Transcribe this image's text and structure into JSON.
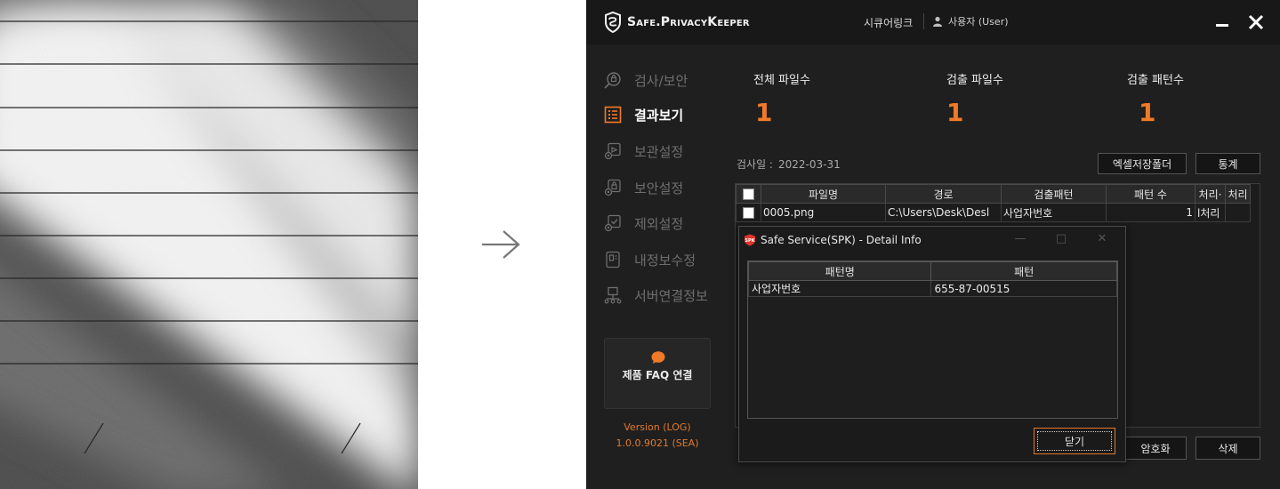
{
  "window": {
    "brand": "Safe.PrivacyKeeper",
    "link": "시큐어링크",
    "user": "사용자 (User)"
  },
  "sidebar": {
    "items": [
      {
        "label": "검사/보안",
        "icon": "shield-search-icon"
      },
      {
        "label": "결과보기",
        "icon": "list-icon",
        "active": true
      },
      {
        "label": "보관설정",
        "icon": "archive-gear-icon"
      },
      {
        "label": "보안설정",
        "icon": "lock-gear-icon"
      },
      {
        "label": "제외설정",
        "icon": "check-gear-icon"
      },
      {
        "label": "내정보수정",
        "icon": "id-card-icon"
      },
      {
        "label": "서버연결정보",
        "icon": "server-network-icon"
      }
    ],
    "faq_label": "제품 FAQ 연결",
    "version_line1": "Version (LOG)",
    "version_line2": "1.0.0.9021 (SEA)"
  },
  "stats": {
    "total_files_label": "전체 파일수",
    "total_files_value": "1",
    "detected_files_label": "검출 파일수",
    "detected_files_value": "1",
    "detected_patterns_label": "검출 패턴수",
    "detected_patterns_value": "1"
  },
  "scan": {
    "date_label": "검사일 :",
    "date_value": "2022-03-31"
  },
  "buttons": {
    "excel_folder": "엑셀저장폴더",
    "stats": "통계",
    "encrypt": "암호화",
    "delete": "삭제"
  },
  "results_table": {
    "headers": [
      "파일명",
      "경로",
      "검출패턴",
      "패턴 수",
      "처리·",
      "처리"
    ],
    "rows": [
      {
        "filename": "0005.png",
        "path": "C:\\Users\\Desk\\Desl",
        "pattern": "사업자번호",
        "count": "1",
        "proc1": "l처리",
        "proc2": ""
      }
    ]
  },
  "dialog": {
    "title": "Safe Service(SPK) - Detail Info",
    "headers": [
      "패턴명",
      "패턴"
    ],
    "rows": [
      {
        "name": "사업자번호",
        "value": "655-87-00515"
      }
    ],
    "ok_label": "닫기"
  },
  "colors": {
    "accent": "#f07a28",
    "app_bg": "#1f1f1f",
    "titlebar_bg": "#181818"
  }
}
